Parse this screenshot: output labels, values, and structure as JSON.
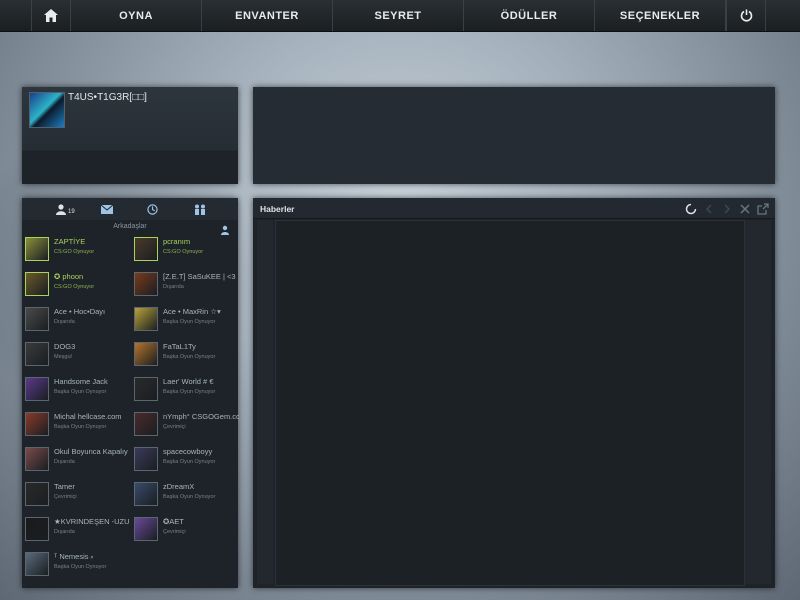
{
  "nav": {
    "play": "OYNA",
    "inventory": "ENVANTER",
    "watch": "SEYRET",
    "awards": "ÖDÜLLER",
    "options": "SEÇENEKLER"
  },
  "profile": {
    "name": "T4US•T1G3R[□□]"
  },
  "friends": {
    "count": "19",
    "list_label": "Arkadaşlar",
    "items": [
      {
        "name": "ZAPTİYE",
        "status": "CS:GO Oynuyor"
      },
      {
        "name": "pcranım",
        "status": "CS:GO Oynuyor"
      },
      {
        "name": "✪ phoon",
        "status": "CS:GO Oynuyor"
      },
      {
        "name": "[Z.E.T] SaSuKEE | <3",
        "status": "Dışarıda"
      },
      {
        "name": "Ace • Hoc▪Dayı",
        "status": "Dışarıda"
      },
      {
        "name": "Ace • MaxRin ☆▾",
        "status": "Başka Oyun Oynuyor"
      },
      {
        "name": "DOG3",
        "status": "Meşgul"
      },
      {
        "name": "FaTaL1Ty",
        "status": "Başka Oyun Oynuyor"
      },
      {
        "name": "Handsome Jack",
        "status": "Başka Oyun Oynuyor"
      },
      {
        "name": "Laer' World # €",
        "status": "Başka Oyun Oynuyor"
      },
      {
        "name": "Michal hellcase.com",
        "status": "Başka Oyun Oynuyor"
      },
      {
        "name": "nYmph° CSGOGem.cc",
        "status": "Çevrimiçi"
      },
      {
        "name": "Okul Boyunca Kapalıy",
        "status": "Dışarıda"
      },
      {
        "name": "spacecowboyy",
        "status": "Başka Oyun Oynuyor"
      },
      {
        "name": "Tamer",
        "status": "Çevrimiçi"
      },
      {
        "name": "zDreamX",
        "status": "Başka Oyun Oynuyor"
      },
      {
        "name": "★KVRINDEŞEN -UZUN",
        "status": "Dışarıda"
      },
      {
        "name": "✪AET",
        "status": "Çevrimiçi"
      },
      {
        "name": "ᵀ Nemesis ⸗",
        "status": "Başka Oyun Oynuyor"
      }
    ]
  },
  "news": {
    "title": "Haberler"
  },
  "colors": {
    "accent_ingame": "#a8d45a",
    "panel_bg": "#1d2329",
    "nav_bg": "#1f2427"
  },
  "icons": [
    "home-icon",
    "power-icon",
    "person-icon",
    "mail-icon",
    "clock-icon",
    "group-icon",
    "add-friend-icon",
    "loading-icon",
    "close-icon",
    "popout-icon"
  ]
}
